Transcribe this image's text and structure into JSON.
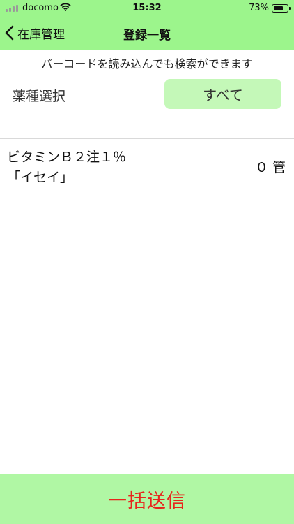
{
  "status_bar": {
    "carrier": "docomo",
    "time": "15:32",
    "battery_percent_text": "73%",
    "battery_level": 0.73,
    "signal_icon": "signal-bars-icon",
    "wifi_icon": "wifi-icon"
  },
  "nav": {
    "back_label": "在庫管理",
    "back_icon": "chevron-left-icon",
    "title": "登録一覧"
  },
  "search_hint": "バーコードを読み込んでも検索ができます",
  "filter": {
    "label": "薬種選択",
    "selected_value": "すべて"
  },
  "items": [
    {
      "name": "ビタミンＢ２注１％\n「イセイ」",
      "quantity": "０ 管"
    }
  ],
  "bottom_action": {
    "label": "一括送信"
  },
  "colors": {
    "nav_background": "#9cf58c",
    "filter_button_background": "#c4f8b8",
    "bottom_bar_background": "#b0f7a4",
    "bottom_label_color": "#e8251c"
  }
}
